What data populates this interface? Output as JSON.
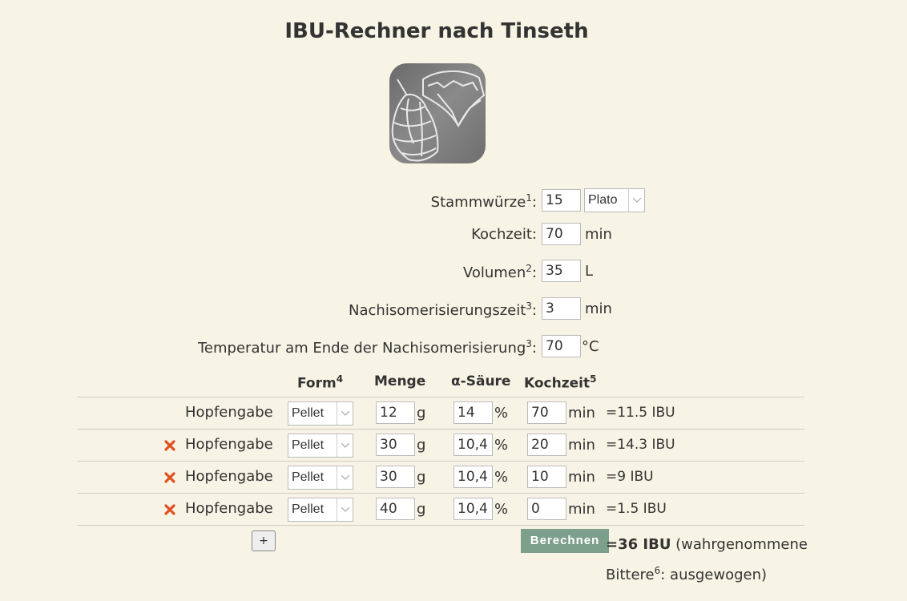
{
  "title": "IBU-Rechner nach Tinseth",
  "fields": {
    "stammwuerze": {
      "label": "Stammwürze",
      "sup": "1",
      "colon": ":",
      "value": "15",
      "unit_select": "Plato"
    },
    "kochzeit": {
      "label": "Kochzeit:",
      "value": "70",
      "unit": "min"
    },
    "volumen": {
      "label": "Volumen",
      "sup": "2",
      "colon": ":",
      "value": "35",
      "unit": "L"
    },
    "nachiso": {
      "label": "Nachisomerisierungszeit",
      "sup": "3",
      "colon": ":",
      "value": "3",
      "unit": "min"
    },
    "temperatur": {
      "label": "Temperatur am Ende der Nachisomerisierung",
      "sup": "3",
      "colon": ":",
      "value": "70",
      "unit": "°C"
    }
  },
  "table": {
    "headers": {
      "form": "Form",
      "form_sup": "4",
      "menge": "Menge",
      "alpha": "α-Säure",
      "kochzeit": "Kochzeit",
      "kochzeit_sup": "5"
    },
    "units": {
      "menge": "g",
      "alpha": "%",
      "kochzeit": "min"
    },
    "rows": [
      {
        "label": "Hopfengabe",
        "deletable": false,
        "form": "Pellet",
        "menge": "12",
        "alpha": "14",
        "kochzeit": "70",
        "ibu": "=11.5 IBU"
      },
      {
        "label": "Hopfengabe",
        "deletable": true,
        "form": "Pellet",
        "menge": "30",
        "alpha": "10,4",
        "kochzeit": "20",
        "ibu": "=14.3 IBU"
      },
      {
        "label": "Hopfengabe",
        "deletable": true,
        "form": "Pellet",
        "menge": "30",
        "alpha": "10,4",
        "kochzeit": "10",
        "ibu": "=9 IBU"
      },
      {
        "label": "Hopfengabe",
        "deletable": true,
        "form": "Pellet",
        "menge": "40",
        "alpha": "10,4",
        "kochzeit": "0",
        "ibu": "=1.5 IBU"
      }
    ]
  },
  "buttons": {
    "add": "+",
    "calculate": "Berechnen"
  },
  "result": {
    "total": "=36 IBU",
    "text1": " (wahrgenommene Bittere",
    "sup": "6",
    "text2": ": ausgewogen)"
  },
  "colors": {
    "accent": "#7da08c",
    "delete": "#e05020",
    "background": "#f7f3e5"
  }
}
